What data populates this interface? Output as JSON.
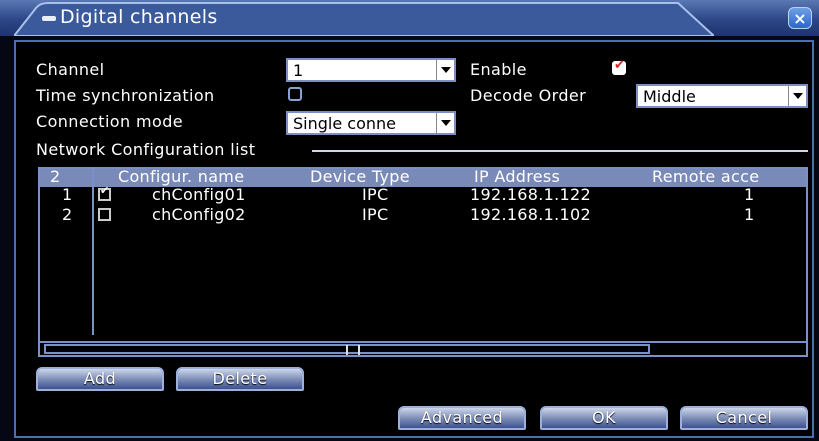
{
  "window": {
    "title": "Digital channels",
    "close_label": "×"
  },
  "form": {
    "channel_label": "Channel",
    "channel_value": "1",
    "enable_label": "Enable",
    "enable_checked": true,
    "timesync_label": "Time synchronization",
    "timesync_checked": false,
    "decode_order_label": "Decode Order",
    "decode_order_value": "Middle",
    "connection_mode_label": "Connection mode",
    "connection_mode_value": "Single conne"
  },
  "list": {
    "group_label": "Network Configuration list",
    "headers": [
      "2",
      "Configur. name",
      "Device Type",
      "IP Address",
      "Remote acce"
    ],
    "rows": [
      {
        "num": "1",
        "checked": true,
        "name": "chConfig01",
        "type": "IPC",
        "ip": "192.168.1.122",
        "remote": "1"
      },
      {
        "num": "2",
        "checked": false,
        "name": "chConfig02",
        "type": "IPC",
        "ip": "192.168.1.102",
        "remote": "1"
      }
    ]
  },
  "buttons": {
    "add": "Add",
    "delete": "Delete",
    "advanced": "Advanced",
    "ok": "OK",
    "cancel": "Cancel"
  }
}
